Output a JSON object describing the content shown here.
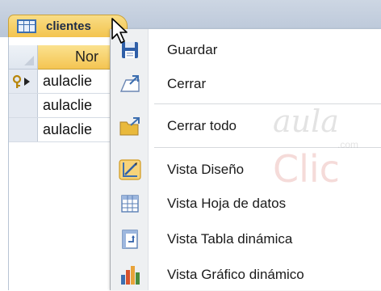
{
  "tab": {
    "label": "clientes",
    "icon": "table-icon"
  },
  "datasheet": {
    "column_header": "Nor",
    "rows": [
      {
        "value": "aulaclie",
        "icon": "key-arrow-icon"
      },
      {
        "value": "aulaclie"
      },
      {
        "value": "aulaclie"
      }
    ]
  },
  "menu": {
    "items": [
      {
        "label": "Guardar",
        "icon": "save-icon"
      },
      {
        "label": "Cerrar",
        "icon": "close-document-icon"
      },
      {
        "label": "Cerrar todo",
        "icon": "close-all-icon"
      },
      {
        "label": "Vista Diseño",
        "icon": "design-view-icon"
      },
      {
        "label": "Vista Hoja de datos",
        "icon": "datasheet-view-icon"
      },
      {
        "label": "Vista Tabla dinámica",
        "icon": "pivot-table-icon"
      },
      {
        "label": "Vista Gráfico dinámico",
        "icon": "pivot-chart-icon"
      }
    ]
  },
  "watermark": {
    "line1": "aula",
    "line2": "Clic",
    "suffix": ".com"
  },
  "colors": {
    "tab_active": "#f4c552",
    "header_strip": "#c4cfdd",
    "menu_gutter": "#eef0f2",
    "accent_blue": "#3d6fb0"
  }
}
